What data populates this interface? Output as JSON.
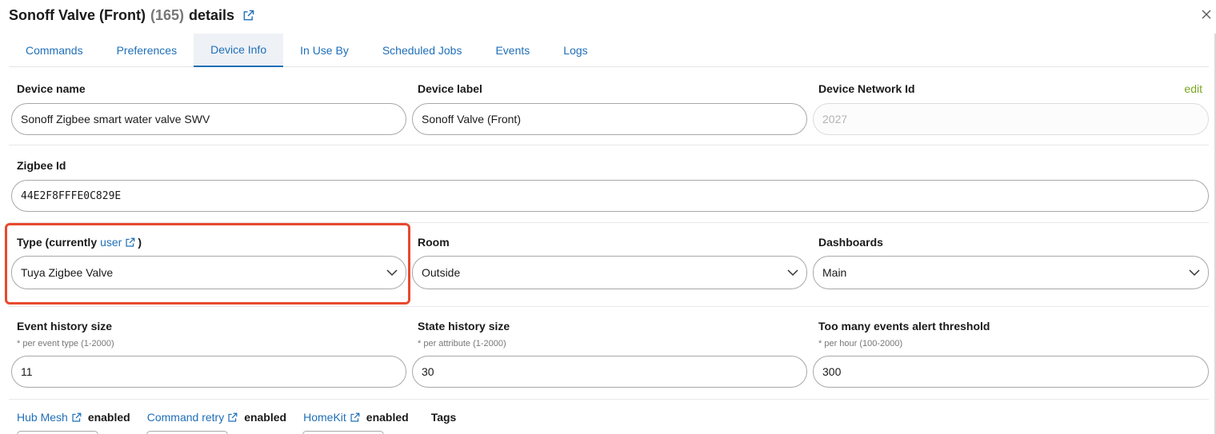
{
  "title": {
    "name": "Sonoff Valve (Front)",
    "count": "(165)",
    "suffix": "details"
  },
  "tabs": [
    {
      "label": "Commands"
    },
    {
      "label": "Preferences"
    },
    {
      "label": "Device Info"
    },
    {
      "label": "In Use By"
    },
    {
      "label": "Scheduled Jobs"
    },
    {
      "label": "Events"
    },
    {
      "label": "Logs"
    }
  ],
  "active_tab": "Device Info",
  "fields": {
    "device_name": {
      "label": "Device name",
      "value": "Sonoff Zigbee smart water valve SWV"
    },
    "device_label": {
      "label": "Device label",
      "value": "Sonoff Valve (Front)"
    },
    "device_network_id": {
      "label": "Device Network Id",
      "value": "2027",
      "action": "edit"
    },
    "zigbee_id": {
      "label": "Zigbee Id",
      "value": "44E2F8FFFE0C829E"
    },
    "type": {
      "label_prefix": "Type (currently",
      "label_link": "user",
      "label_suffix": ")",
      "value": "Tuya Zigbee Valve"
    },
    "room": {
      "label": "Room",
      "value": "Outside"
    },
    "dashboards": {
      "label": "Dashboards",
      "value": "Main"
    },
    "event_history": {
      "label": "Event history size",
      "hint": "* per event type (1-2000)",
      "value": "11"
    },
    "state_history": {
      "label": "State history size",
      "hint": "* per attribute (1-2000)",
      "value": "30"
    },
    "alert_threshold": {
      "label": "Too many events alert threshold",
      "hint": "* per hour (100-2000)",
      "value": "300"
    }
  },
  "features": {
    "hub_mesh": {
      "label": "Hub Mesh",
      "state": "enabled"
    },
    "command_retry": {
      "label": "Command retry",
      "state": "enabled"
    },
    "homekit": {
      "label": "HomeKit",
      "state": "enabled"
    },
    "tags_label": "Tags"
  },
  "colors": {
    "link": "#1f6fb8",
    "edit": "#7aa51e",
    "highlight": "#e8492f"
  }
}
